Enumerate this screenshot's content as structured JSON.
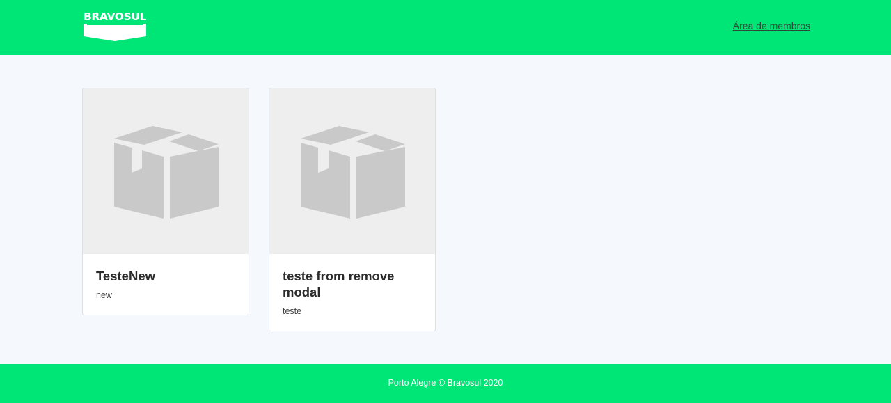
{
  "header": {
    "logo_text": "BRAVOSUL",
    "members_link": "Área de membros"
  },
  "products": [
    {
      "title": "TesteNew",
      "description": "new",
      "image_icon": "package-box-icon"
    },
    {
      "title": "teste from remove modal",
      "description": "teste",
      "image_icon": "package-box-icon"
    }
  ],
  "footer": {
    "text": "Porto Alegre © Bravosul 2020"
  },
  "colors": {
    "brand_green": "#00e676",
    "page_background": "#f5f9fe",
    "image_placeholder": "#eeeeee",
    "box_icon": "#c9c9c9"
  }
}
